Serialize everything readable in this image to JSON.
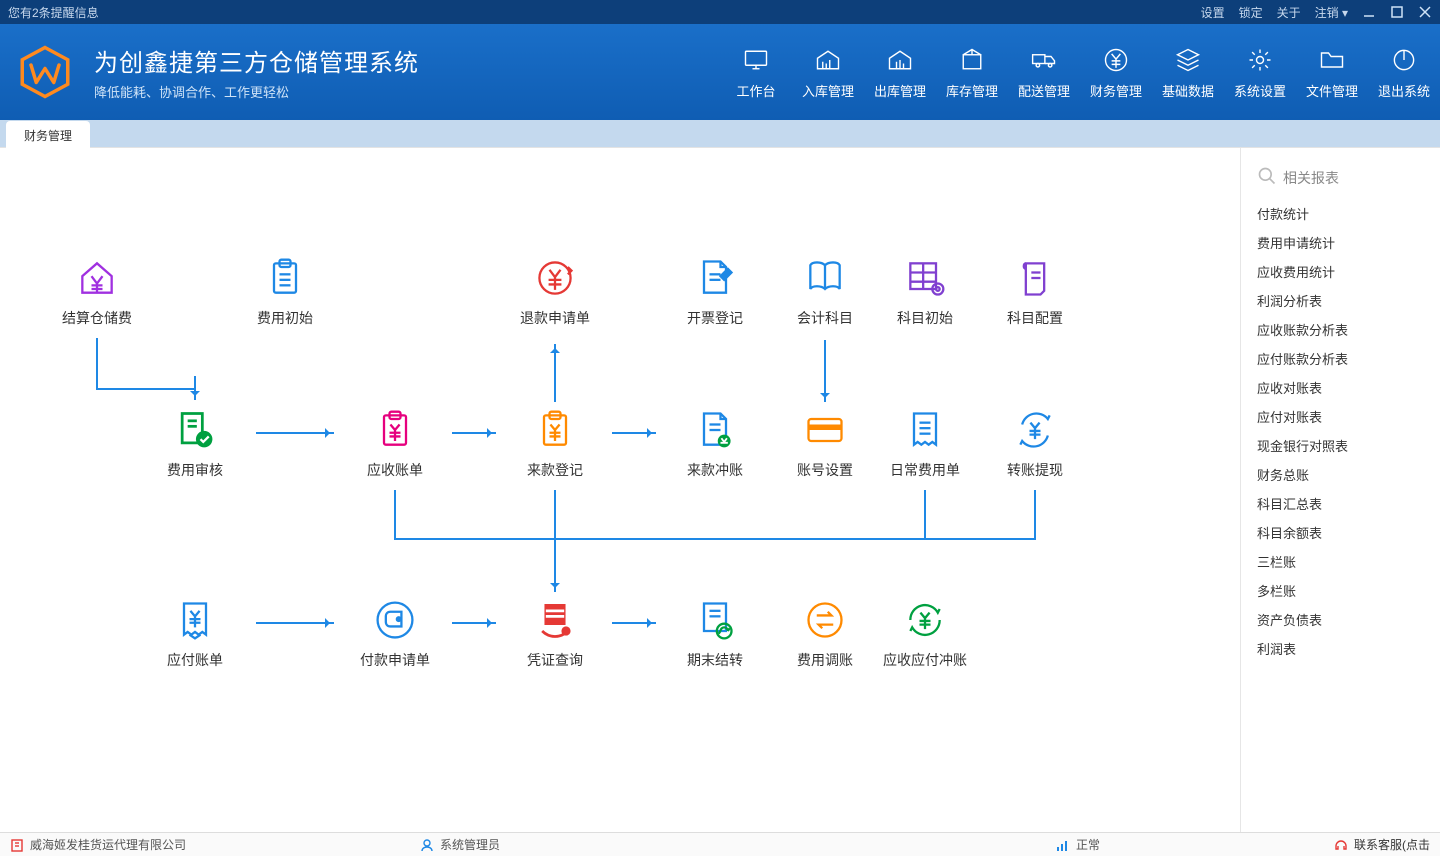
{
  "titlebar": {
    "notice": "您有2条提醒信息",
    "settings": "设置",
    "lock": "锁定",
    "about": "关于",
    "logout": "注销"
  },
  "brand": {
    "title": "为创鑫捷第三方仓储管理系统",
    "subtitle": "降低能耗、协调合作、工作更轻松"
  },
  "navs": [
    {
      "id": "workbench",
      "label": "工作台"
    },
    {
      "id": "inbound",
      "label": "入库管理"
    },
    {
      "id": "outbound",
      "label": "出库管理"
    },
    {
      "id": "inventory",
      "label": "库存管理"
    },
    {
      "id": "delivery",
      "label": "配送管理"
    },
    {
      "id": "finance",
      "label": "财务管理"
    },
    {
      "id": "basedata",
      "label": "基础数据"
    },
    {
      "id": "syssetting",
      "label": "系统设置"
    },
    {
      "id": "files",
      "label": "文件管理"
    },
    {
      "id": "exit",
      "label": "退出系统"
    }
  ],
  "tab": {
    "label": "财务管理"
  },
  "nodes": {
    "settle_storage": "结算仓储费",
    "fee_init": "费用初始",
    "refund_req": "退款申请单",
    "invoice_reg": "开票登记",
    "account_subject": "会计科目",
    "subject_init": "科目初始",
    "subject_config": "科目配置",
    "fee_review": "费用审核",
    "receivable": "应收账单",
    "payment_in_reg": "来款登记",
    "payment_in_offset": "来款冲账",
    "account_setting": "账号设置",
    "daily_fee": "日常费用单",
    "transfer_withdraw": "转账提现",
    "payable": "应付账单",
    "payment_req": "付款申请单",
    "voucher_query": "凭证查询",
    "period_close": "期末结转",
    "fee_adjust": "费用调账",
    "ar_ap_offset": "应收应付冲账"
  },
  "reports_header": "相关报表",
  "reports": [
    "付款统计",
    "费用申请统计",
    "应收费用统计",
    "利润分析表",
    "应收账款分析表",
    "应付账款分析表",
    "应收对账表",
    "应付对账表",
    "现金银行对照表",
    "财务总账",
    "科目汇总表",
    "科目余额表",
    "三栏账",
    "多栏账",
    "资产负债表",
    "利润表"
  ],
  "status": {
    "company": "威海姬发桂货运代理有限公司",
    "user": "系统管理员",
    "net": "正常",
    "help": "联系客服(点击"
  }
}
